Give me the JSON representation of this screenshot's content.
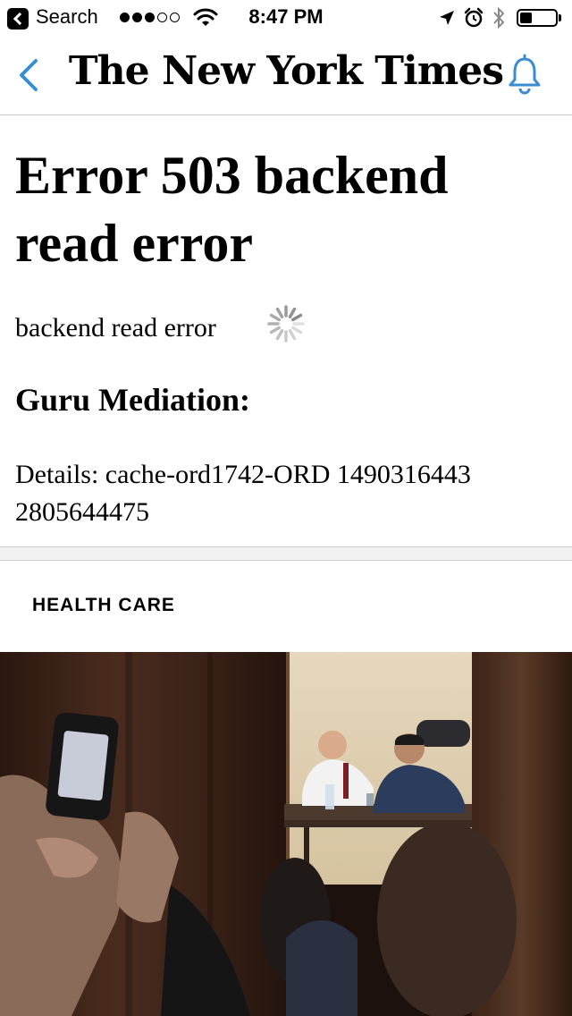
{
  "status_bar": {
    "back_app_label": "Search",
    "signal_dots": [
      "full",
      "full",
      "full",
      "empty",
      "empty"
    ],
    "time": "8:47 PM",
    "battery_level": 0.35
  },
  "nav": {
    "logo_text": "The New York Times",
    "back_icon": "chevron-left-icon",
    "bell_icon": "bell-icon",
    "accent_color": "#3b8dd1"
  },
  "error": {
    "title": "Error 503 backend read error",
    "message": "backend read error",
    "guru_label": "Guru Mediation:",
    "details": "Details: cache-ord1742-ORD 1490316443 2805644475"
  },
  "section": {
    "label": "HEALTH CARE"
  }
}
